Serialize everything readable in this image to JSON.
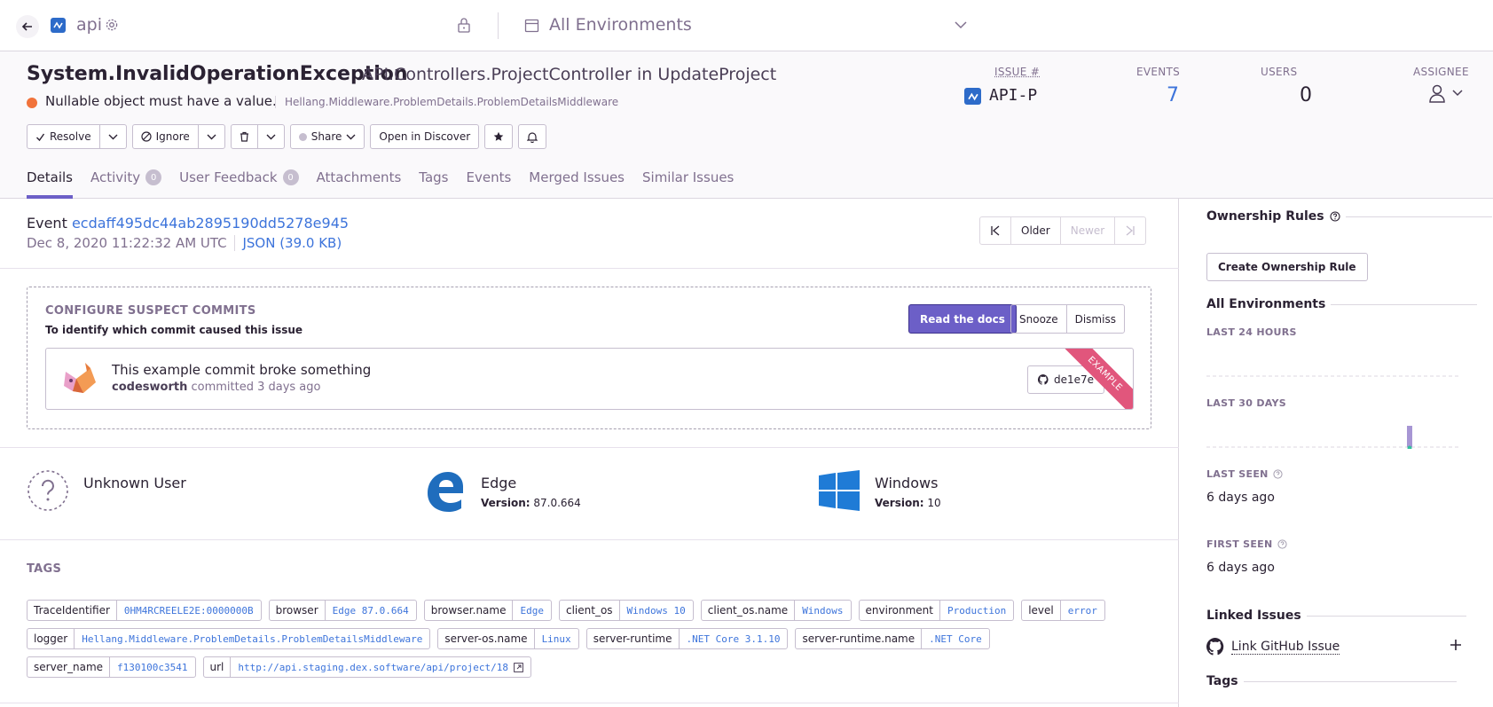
{
  "topbar": {
    "project": "api",
    "environment": "All Environments"
  },
  "issue": {
    "title": "System.InvalidOperationException",
    "culprit": "API.Controllers.ProjectController in UpdateProject",
    "message": "Nullable object must have a value.",
    "location": "Hellang.Middleware.ProblemDetails.ProblemDetailsMiddleware",
    "level_color": "#f1733b"
  },
  "stats": {
    "issue_label": "ISSUE #",
    "issue_id": "API-P",
    "events_label": "EVENTS",
    "events": "7",
    "users_label": "USERS",
    "users": "0",
    "assignee_label": "ASSIGNEE"
  },
  "actions": {
    "resolve": "Resolve",
    "ignore": "Ignore",
    "share": "Share",
    "discover": "Open in Discover"
  },
  "tabs": [
    {
      "label": "Details"
    },
    {
      "label": "Activity",
      "badge": "0"
    },
    {
      "label": "User Feedback",
      "badge": "0"
    },
    {
      "label": "Attachments"
    },
    {
      "label": "Tags"
    },
    {
      "label": "Events"
    },
    {
      "label": "Merged Issues"
    },
    {
      "label": "Similar Issues"
    }
  ],
  "event": {
    "label": "Event",
    "id": "ecdaff495dc44ab2895190dd5278e945",
    "date": "Dec 8, 2020 11:22:32 AM UTC",
    "json": "JSON (39.0 KB)",
    "older": "Older",
    "newer": "Newer"
  },
  "suspect": {
    "title": "CONFIGURE SUSPECT COMMITS",
    "subtitle": "To identify which commit caused this issue",
    "docs": "Read the docs",
    "snooze": "Snooze",
    "dismiss": "Dismiss",
    "commit_message": "This example commit broke something",
    "commit_author": "codesworth",
    "commit_time": "committed 3 days ago",
    "sha": "de1e7e",
    "ribbon": "EXAMPLE"
  },
  "context": {
    "user": "Unknown User",
    "browser": "Edge",
    "browser_version_label": "Version:",
    "browser_version": "87.0.664",
    "os": "Windows",
    "os_version_label": "Version:",
    "os_version": "10"
  },
  "tags_title": "TAGS",
  "tags": [
    {
      "key": "TraceIdentifier",
      "value": "0HM4RCREELE2E:0000000B"
    },
    {
      "key": "browser",
      "value": "Edge 87.0.664"
    },
    {
      "key": "browser.name",
      "value": "Edge"
    },
    {
      "key": "client_os",
      "value": "Windows 10"
    },
    {
      "key": "client_os.name",
      "value": "Windows"
    },
    {
      "key": "environment",
      "value": "Production"
    },
    {
      "key": "level",
      "value": "error"
    },
    {
      "key": "logger",
      "value": "Hellang.Middleware.ProblemDetails.ProblemDetailsMiddleware"
    },
    {
      "key": "server-os.name",
      "value": "Linux"
    },
    {
      "key": "server-runtime",
      "value": ".NET Core 3.1.10"
    },
    {
      "key": "server-runtime.name",
      "value": ".NET Core"
    },
    {
      "key": "server_name",
      "value": "f130100c3541"
    },
    {
      "key": "url",
      "value": "http://api.staging.dex.software/api/project/18"
    }
  ],
  "sidebar": {
    "ownership_title": "Ownership Rules",
    "ownership_button": "Create Ownership Rule",
    "env_title": "All Environments",
    "last24": "LAST 24 HOURS",
    "last30": "LAST 30 DAYS",
    "last_seen_label": "LAST SEEN",
    "last_seen": "6 days ago",
    "first_seen_label": "FIRST SEEN",
    "first_seen": "6 days ago",
    "linked_title": "Linked Issues",
    "github_link": "Link GitHub Issue",
    "tags_title": "Tags"
  },
  "colors": {
    "accent": "#6c5fc7",
    "link": "#3d74db",
    "ribbon": "#e1567c"
  }
}
